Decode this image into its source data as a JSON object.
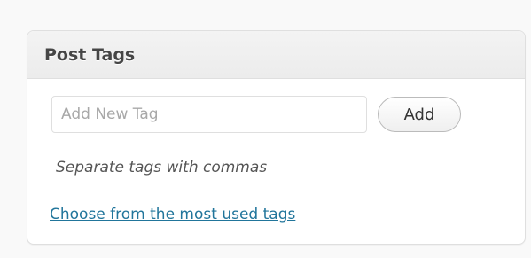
{
  "metabox": {
    "title": "Post Tags"
  },
  "tag_input": {
    "value": "",
    "placeholder": "Add New Tag"
  },
  "add_button": {
    "label": "Add"
  },
  "help_text": "Separate tags with commas",
  "most_used_link": "Choose from the most used tags",
  "colors": {
    "link": "#21759b",
    "header_background": "#ececec",
    "border": "#dfdfdf"
  }
}
